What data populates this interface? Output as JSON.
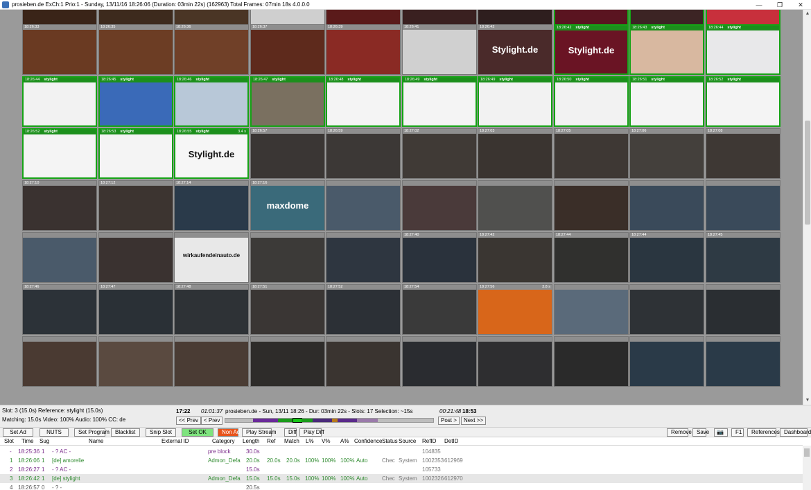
{
  "window": {
    "title": "prosieben.de ExCh:1 Prio:1 - Sunday, 13/11/16 18:26:06 (Duration: 03min 22s) (162963) Total Frames: 07min 18s 4.0.0.0",
    "min_glyph": "—",
    "max_glyph": "❐",
    "close_glyph": "✕"
  },
  "colors": {
    "ad_border": "#15a315",
    "ad_header": "#1c8f1c",
    "normal_header": "#8e8e8e",
    "set_ok": "#7ee37e",
    "non_ad": "#e8541c"
  },
  "grid": {
    "rows": [
      [
        {
          "time": "",
          "label": "",
          "dur": "",
          "bg": "#3a2418",
          "ad": false,
          "txt": ""
        },
        {
          "time": "",
          "label": "",
          "dur": "",
          "bg": "#3d2a1d",
          "ad": false,
          "txt": ""
        },
        {
          "time": "",
          "label": "",
          "dur": "",
          "bg": "#4a3525",
          "ad": false,
          "txt": ""
        },
        {
          "time": "",
          "label": "",
          "dur": "",
          "bg": "#cfcfcf",
          "ad": false,
          "txt": ""
        },
        {
          "time": "",
          "label": "",
          "dur": "",
          "bg": "#5a1a1a",
          "ad": false,
          "txt": ""
        },
        {
          "time": "",
          "label": "",
          "dur": "",
          "bg": "#3a2020",
          "ad": false,
          "txt": ""
        },
        {
          "time": "",
          "label": "",
          "dur": "",
          "bg": "#2e1e1e",
          "ad": false,
          "txt": ""
        },
        {
          "time": "",
          "label": "",
          "dur": "",
          "bg": "#5a1420",
          "ad": true,
          "txt": ""
        },
        {
          "time": "",
          "label": "",
          "dur": "",
          "bg": "#3c2424",
          "ad": true,
          "txt": ""
        },
        {
          "time": "",
          "label": "",
          "dur": "",
          "bg": "#c8303c",
          "ad": true,
          "txt": ""
        }
      ],
      [
        {
          "time": "18:26:33",
          "label": "",
          "dur": "",
          "bg": "#6a3a22",
          "ad": false,
          "txt": ""
        },
        {
          "time": "18:26:35",
          "label": "",
          "dur": "",
          "bg": "#6c3d24",
          "ad": false,
          "txt": ""
        },
        {
          "time": "18:26:36",
          "label": "",
          "dur": "",
          "bg": "#704028",
          "ad": false,
          "txt": ""
        },
        {
          "time": "18:26:37",
          "label": "",
          "dur": "",
          "bg": "#5e2a1c",
          "ad": false,
          "txt": ""
        },
        {
          "time": "18:26:39",
          "label": "",
          "dur": "",
          "bg": "#8a2a24",
          "ad": false,
          "txt": ""
        },
        {
          "time": "18:26:41",
          "label": "",
          "dur": "",
          "bg": "#d0d0d0",
          "ad": false,
          "txt": ""
        },
        {
          "time": "18:26:42",
          "label": "",
          "dur": "",
          "bg": "#4a2a2a",
          "ad": false,
          "txt": "Stylight.de"
        },
        {
          "time": "18:26:42",
          "label": "stylight",
          "dur": "",
          "bg": "#6a1424",
          "ad": true,
          "txt": "Stylight.de"
        },
        {
          "time": "18:26:43",
          "label": "stylight",
          "dur": "",
          "bg": "#d8b8a0",
          "ad": true,
          "txt": ""
        },
        {
          "time": "18:26:44",
          "label": "stylight",
          "dur": "",
          "bg": "#e8e8ea",
          "ad": true,
          "txt": ""
        }
      ],
      [
        {
          "time": "18:26:44",
          "label": "stylight",
          "dur": "",
          "bg": "#f2f2f2",
          "ad": true,
          "txt": ""
        },
        {
          "time": "18:26:45",
          "label": "stylight",
          "dur": "",
          "bg": "#3a6ab8",
          "ad": true,
          "txt": ""
        },
        {
          "time": "18:26:46",
          "label": "stylight",
          "dur": "",
          "bg": "#b8c8d8",
          "ad": true,
          "txt": ""
        },
        {
          "time": "18:26:47",
          "label": "stylight",
          "dur": "",
          "bg": "#7a7060",
          "ad": true,
          "txt": ""
        },
        {
          "time": "18:26:48",
          "label": "stylight",
          "dur": "",
          "bg": "#f4f4f4",
          "ad": true,
          "txt": ""
        },
        {
          "time": "18:26:49",
          "label": "stylight",
          "dur": "",
          "bg": "#f4f4f4",
          "ad": true,
          "txt": ""
        },
        {
          "time": "18:26:49",
          "label": "stylight",
          "dur": "",
          "bg": "#f2f2f2",
          "ad": true,
          "txt": ""
        },
        {
          "time": "18:26:50",
          "label": "stylight",
          "dur": "",
          "bg": "#f2f2f2",
          "ad": true,
          "txt": ""
        },
        {
          "time": "18:26:51",
          "label": "stylight",
          "dur": "",
          "bg": "#f4f4f4",
          "ad": true,
          "txt": ""
        },
        {
          "time": "18:26:52",
          "label": "stylight",
          "dur": "",
          "bg": "#f4f4f4",
          "ad": true,
          "txt": ""
        }
      ],
      [
        {
          "time": "18:26:52",
          "label": "stylight",
          "dur": "",
          "bg": "#f4f4f4",
          "ad": true,
          "txt": ""
        },
        {
          "time": "18:26:53",
          "label": "stylight",
          "dur": "",
          "bg": "#f4f4f4",
          "ad": true,
          "txt": ""
        },
        {
          "time": "18:26:55",
          "label": "stylight",
          "dur": "3.4 s",
          "bg": "#f6f6f6",
          "ad": true,
          "txt": "Stylight.de",
          "dark": true
        },
        {
          "time": "18:26:57",
          "label": "",
          "dur": "",
          "bg": "#3a3634",
          "ad": false,
          "txt": ""
        },
        {
          "time": "18:26:59",
          "label": "",
          "dur": "",
          "bg": "#3c3836",
          "ad": false,
          "txt": ""
        },
        {
          "time": "18:27:02",
          "label": "",
          "dur": "",
          "bg": "#403a36",
          "ad": false,
          "txt": ""
        },
        {
          "time": "18:27:03",
          "label": "",
          "dur": "",
          "bg": "#3a3430",
          "ad": false,
          "txt": ""
        },
        {
          "time": "18:27:05",
          "label": "",
          "dur": "",
          "bg": "#3e3834",
          "ad": false,
          "txt": ""
        },
        {
          "time": "18:27:06",
          "label": "",
          "dur": "",
          "bg": "#44403c",
          "ad": false,
          "txt": ""
        },
        {
          "time": "18:27:08",
          "label": "",
          "dur": "",
          "bg": "#3e3834",
          "ad": false,
          "txt": ""
        }
      ],
      [
        {
          "time": "18:27:10",
          "label": "",
          "dur": "",
          "bg": "#3a3230",
          "ad": false,
          "txt": ""
        },
        {
          "time": "18:27:12",
          "label": "",
          "dur": "",
          "bg": "#3c3430",
          "ad": false,
          "txt": ""
        },
        {
          "time": "18:27:14",
          "label": "",
          "dur": "",
          "bg": "#2a3a4a",
          "ad": false,
          "txt": ""
        },
        {
          "time": "18:27:16",
          "label": "",
          "dur": "",
          "bg": "#3a6a7a",
          "ad": false,
          "txt": "maxdome"
        },
        {
          "time": "",
          "label": "",
          "dur": "",
          "bg": "#4a5a6a",
          "ad": false,
          "txt": ""
        },
        {
          "time": "",
          "label": "",
          "dur": "",
          "bg": "#4a3a3a",
          "ad": false,
          "txt": ""
        },
        {
          "time": "",
          "label": "",
          "dur": "",
          "bg": "#50504e",
          "ad": false,
          "txt": ""
        },
        {
          "time": "",
          "label": "",
          "dur": "",
          "bg": "#3a2e28",
          "ad": false,
          "txt": ""
        },
        {
          "time": "",
          "label": "",
          "dur": "",
          "bg": "#3a4a5a",
          "ad": false,
          "txt": ""
        },
        {
          "time": "",
          "label": "",
          "dur": "",
          "bg": "#3a4a5a",
          "ad": false,
          "txt": ""
        }
      ],
      [
        {
          "time": "",
          "label": "",
          "dur": "",
          "bg": "#4a5a6a",
          "ad": false,
          "txt": ""
        },
        {
          "time": "",
          "label": "",
          "dur": "",
          "bg": "#3a3230",
          "ad": false,
          "txt": ""
        },
        {
          "time": "",
          "label": "",
          "dur": "",
          "bg": "#e8e8e8",
          "ad": false,
          "txt": "wirkaufendeinauto.de",
          "dark": true
        },
        {
          "time": "",
          "label": "",
          "dur": "",
          "bg": "#3c3a38",
          "ad": false,
          "txt": ""
        },
        {
          "time": "",
          "label": "",
          "dur": "",
          "bg": "#2e3640",
          "ad": false,
          "txt": ""
        },
        {
          "time": "18:27:40",
          "label": "",
          "dur": "",
          "bg": "#2a323c",
          "ad": false,
          "txt": ""
        },
        {
          "time": "18:27:42",
          "label": "",
          "dur": "",
          "bg": "#3a3632",
          "ad": false,
          "txt": ""
        },
        {
          "time": "18:27:44",
          "label": "",
          "dur": "",
          "bg": "#30302e",
          "ad": false,
          "txt": ""
        },
        {
          "time": "18:27:44",
          "label": "",
          "dur": "",
          "bg": "#2a3640",
          "ad": false,
          "txt": ""
        },
        {
          "time": "18:27:45",
          "label": "",
          "dur": "",
          "bg": "#2e3a44",
          "ad": false,
          "txt": ""
        }
      ],
      [
        {
          "time": "18:27:46",
          "label": "",
          "dur": "",
          "bg": "#2c3238",
          "ad": false,
          "txt": ""
        },
        {
          "time": "18:27:47",
          "label": "",
          "dur": "",
          "bg": "#2a3036",
          "ad": false,
          "txt": ""
        },
        {
          "time": "18:27:48",
          "label": "",
          "dur": "",
          "bg": "#2e3236",
          "ad": false,
          "txt": ""
        },
        {
          "time": "18:27:51",
          "label": "",
          "dur": "",
          "bg": "#3a3634",
          "ad": false,
          "txt": ""
        },
        {
          "time": "18:27:52",
          "label": "",
          "dur": "",
          "bg": "#2c3036",
          "ad": false,
          "txt": ""
        },
        {
          "time": "18:27:54",
          "label": "",
          "dur": "",
          "bg": "#3a3a3a",
          "ad": false,
          "txt": ""
        },
        {
          "time": "18:27:56",
          "label": "",
          "dur": "3.8 s",
          "bg": "#d8661a",
          "ad": false,
          "txt": ""
        },
        {
          "time": "",
          "label": "",
          "dur": "",
          "bg": "#5a6a7a",
          "ad": false,
          "txt": ""
        },
        {
          "time": "",
          "label": "",
          "dur": "",
          "bg": "#2e3236",
          "ad": false,
          "txt": ""
        },
        {
          "time": "",
          "label": "",
          "dur": "",
          "bg": "#2a2e32",
          "ad": false,
          "txt": ""
        }
      ],
      [
        {
          "time": "",
          "label": "",
          "dur": "",
          "bg": "#4a3a32",
          "ad": false,
          "txt": ""
        },
        {
          "time": "",
          "label": "",
          "dur": "",
          "bg": "#5a4a40",
          "ad": false,
          "txt": ""
        },
        {
          "time": "",
          "label": "",
          "dur": "",
          "bg": "#4a3c34",
          "ad": false,
          "txt": ""
        },
        {
          "time": "",
          "label": "",
          "dur": "",
          "bg": "#2e2c2a",
          "ad": false,
          "txt": ""
        },
        {
          "time": "",
          "label": "",
          "dur": "",
          "bg": "#3a3430",
          "ad": false,
          "txt": ""
        },
        {
          "time": "",
          "label": "",
          "dur": "",
          "bg": "#2a2c30",
          "ad": false,
          "txt": ""
        },
        {
          "time": "",
          "label": "",
          "dur": "",
          "bg": "#2e2e30",
          "ad": false,
          "txt": ""
        },
        {
          "time": "",
          "label": "",
          "dur": "",
          "bg": "#2a2a2a",
          "ad": false,
          "txt": ""
        },
        {
          "time": "",
          "label": "",
          "dur": "",
          "bg": "#2a3a48",
          "ad": false,
          "txt": ""
        },
        {
          "time": "",
          "label": "",
          "dur": "",
          "bg": "#2a3a48",
          "ad": false,
          "txt": ""
        }
      ]
    ]
  },
  "info": {
    "slot_line": "Slot: 3 (15.0s)  Reference: stylight (15.0s)",
    "matching_line": "Matching: 15.0s Video: 100% Audio: 100% CC: de",
    "start_time": "17:22",
    "elapsed": "01:01:37",
    "summary": "prosieben.de - Sun, 13/11 18:26 - Dur: 03min 22s - Slots: 17   Selection: ~15s",
    "remaining": "00:21:48",
    "end_time": "18:53",
    "prev_prev": "<< Prev",
    "prev": "< Prev",
    "post": "Post >",
    "next_next": "Next >>"
  },
  "toolbar": {
    "set_ad": "Set Ad",
    "nuts": "NUTS",
    "set_program": "Set Program",
    "blacklist": "Blacklist",
    "snip_slot": "Snip Slot",
    "set_ok": "Set OK",
    "non_ad": "Non Ad",
    "play_stream": "Play Stream",
    "diff": "Diff",
    "play_diff": "Play Diff",
    "remove": "Remove",
    "save": "Save",
    "camera": "📷",
    "f1": "F1",
    "references": "References",
    "dashboard": "Dashboard"
  },
  "table": {
    "headers": [
      "Slot",
      "Time",
      "Sug",
      "Name",
      "External ID",
      "Category",
      "Length",
      "Ref",
      "Match",
      "L%",
      "V%",
      "A%",
      "Confidence",
      "Status",
      "Source",
      "RefID",
      "DetID"
    ],
    "rows": [
      {
        "slot": "-",
        "time": "18:25:36",
        "sug": "1",
        "name": "- ? AC -",
        "ext": "",
        "cat": "pre block",
        "len": "30.0s",
        "ref": "",
        "match": "",
        "l": "",
        "v": "",
        "a": "",
        "conf": "",
        "status": "",
        "source": "",
        "refid": "104835",
        "detid": "",
        "color": "#7a2a8a"
      },
      {
        "slot": "1",
        "time": "18:26:06",
        "sug": "1",
        "name": "[de] amorelie",
        "ext": "",
        "cat": "Admon_Defa",
        "len": "20.0s",
        "ref": "20.0s",
        "match": "20.0s",
        "l": "100%",
        "v": "100%",
        "a": "100%",
        "conf": "Auto",
        "status": "Chec",
        "source": "System",
        "refid": "1002353",
        "detid": "612969",
        "color": "#2e8a2e"
      },
      {
        "slot": "2",
        "time": "18:26:27",
        "sug": "1",
        "name": "- ? AC -",
        "ext": "",
        "cat": "",
        "len": "15.0s",
        "ref": "",
        "match": "",
        "l": "",
        "v": "",
        "a": "",
        "conf": "",
        "status": "",
        "source": "",
        "refid": "105733",
        "detid": "",
        "color": "#7a2a8a"
      },
      {
        "slot": "3",
        "time": "18:26:42",
        "sug": "1",
        "name": "[de] stylight",
        "ext": "",
        "cat": "Admon_Defa",
        "len": "15.0s",
        "ref": "15.0s",
        "match": "15.0s",
        "l": "100%",
        "v": "100%",
        "a": "100%",
        "conf": "Auto",
        "status": "Chec",
        "source": "System",
        "refid": "1002326",
        "detid": "612970",
        "color": "#2e8a2e"
      },
      {
        "slot": "4",
        "time": "18:26:57",
        "sug": "0",
        "name": "- ? -",
        "ext": "",
        "cat": "",
        "len": "20.5s",
        "ref": "",
        "match": "",
        "l": "",
        "v": "",
        "a": "",
        "conf": "",
        "status": "",
        "source": "",
        "refid": "",
        "detid": "",
        "color": "#555555"
      }
    ]
  }
}
